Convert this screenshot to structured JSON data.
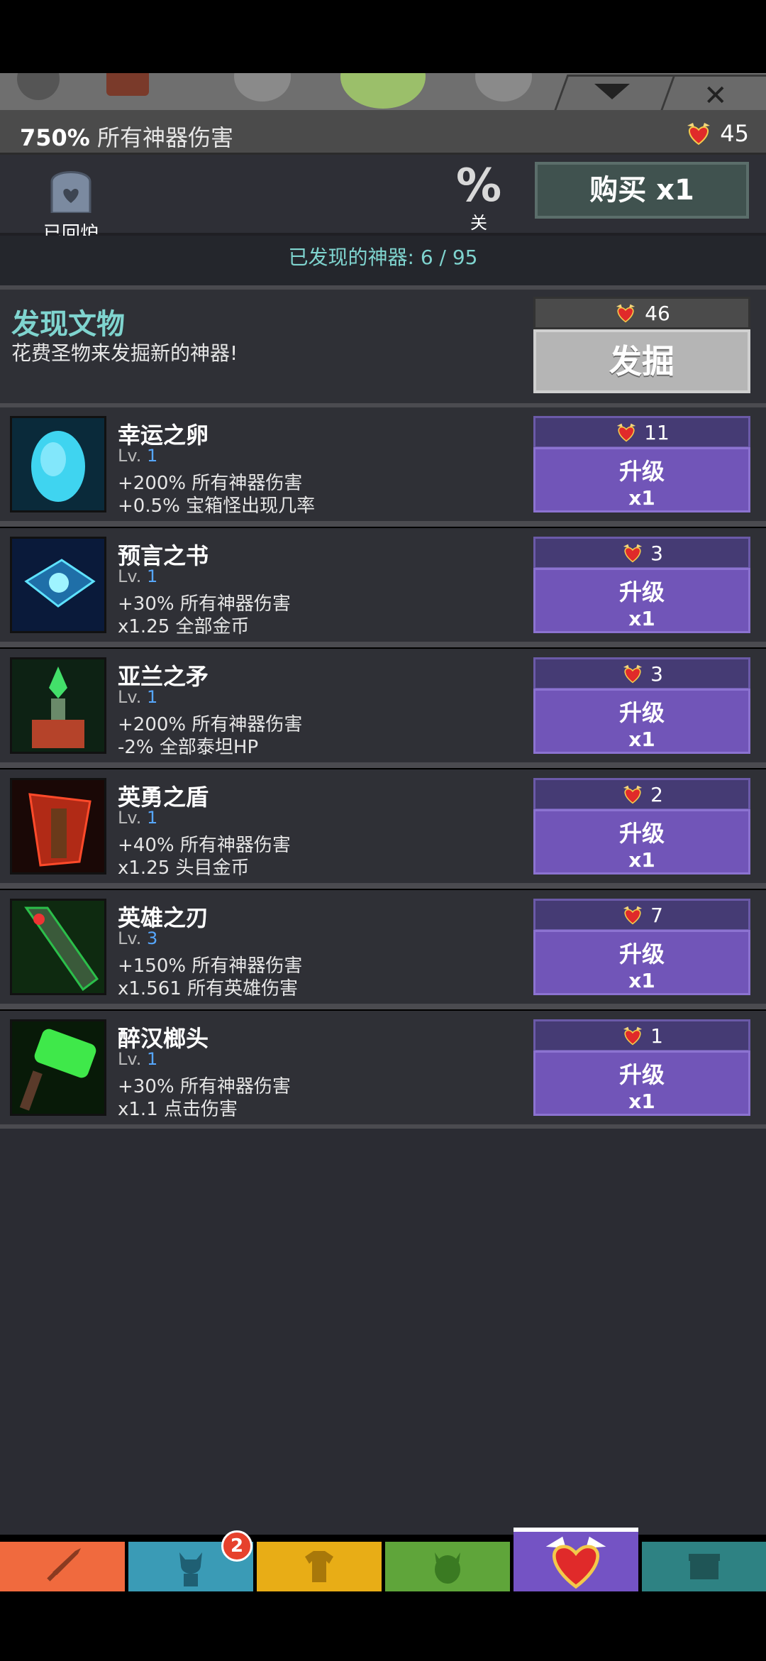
{
  "header": {
    "damage_value": "750%",
    "damage_label": "所有神器伤害",
    "relics": "45"
  },
  "toolbar": {
    "salvage_label": "已回炉",
    "percent_sign": "%",
    "percent_label": "关",
    "buy_label": "购买 x1"
  },
  "discovered": {
    "label": "已发现的神器: 6 / 95"
  },
  "discover_panel": {
    "title": "发现文物",
    "subtitle": "花费圣物来发掘新的神器!",
    "cost": "46",
    "button": "发掘"
  },
  "artifacts": [
    {
      "name": "幸运之卵",
      "lv_prefix": "Lv. ",
      "level": "1",
      "effect1": "+200% 所有神器伤害",
      "effect2": "+0.5% 宝箱怪出现几率",
      "cost": "11",
      "btn1": "升级",
      "btn2": "x1",
      "icon": "glowing-egg-icon"
    },
    {
      "name": "预言之书",
      "lv_prefix": "Lv. ",
      "level": "1",
      "effect1": "+30% 所有神器伤害",
      "effect2": "x1.25 全部金币",
      "cost": "3",
      "btn1": "升级",
      "btn2": "x1",
      "icon": "book-icon"
    },
    {
      "name": "亚兰之矛",
      "lv_prefix": "Lv. ",
      "level": "1",
      "effect1": "+200% 所有神器伤害",
      "effect2": "-2% 全部泰坦HP",
      "cost": "3",
      "btn1": "升级",
      "btn2": "x1",
      "icon": "spear-icon"
    },
    {
      "name": "英勇之盾",
      "lv_prefix": "Lv. ",
      "level": "1",
      "effect1": "+40% 所有神器伤害",
      "effect2": "x1.25 头目金币",
      "cost": "2",
      "btn1": "升级",
      "btn2": "x1",
      "icon": "shield-icon"
    },
    {
      "name": "英雄之刃",
      "lv_prefix": "Lv. ",
      "level": "3",
      "effect1": "+150% 所有神器伤害",
      "effect2": "x1.561 所有英雄伤害",
      "cost": "7",
      "btn1": "升级",
      "btn2": "x1",
      "icon": "blade-icon"
    },
    {
      "name": "醉汉榔头",
      "lv_prefix": "Lv. ",
      "level": "1",
      "effect1": "+30% 所有神器伤害",
      "effect2": "x1.1 点击伤害",
      "cost": "1",
      "btn1": "升级",
      "btn2": "x1",
      "icon": "hammer-icon"
    }
  ],
  "nav": {
    "badge": "2",
    "tabs": [
      "sword-icon",
      "hero-icon",
      "shirt-icon",
      "pet-icon",
      "relic-heart-icon",
      "chest-icon"
    ],
    "colors": [
      "#f06a3e",
      "#3a9bb6",
      "#e8ad16",
      "#5fa53a",
      "#7453c4",
      "#2e8283"
    ]
  },
  "colors": {
    "accent_teal": "#7fd4cf",
    "upgrade_purple": "#7155b8",
    "level_blue": "#56a7ff"
  }
}
